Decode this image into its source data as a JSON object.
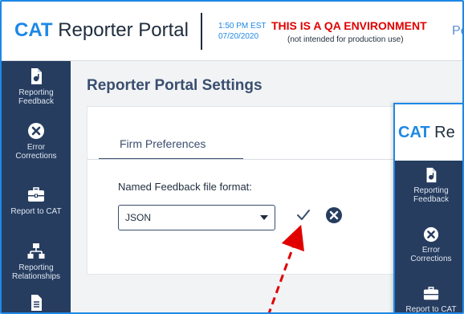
{
  "header": {
    "brand_prefix": "CAT",
    "brand_suffix": " Reporter Portal",
    "time": "1:50 PM EST",
    "date": "07/20/2020",
    "qa_warning": "THIS IS A QA ENVIRONMENT",
    "qa_subtitle": "(not intended for production use)",
    "cut_text": "Pe"
  },
  "sidebar": {
    "items": [
      {
        "label_1": "Reporting",
        "label_2": "Feedback",
        "icon": "document-icon"
      },
      {
        "label_1": "Error",
        "label_2": "Corrections",
        "icon": "error-x-icon"
      },
      {
        "label_1": "Report to CAT",
        "label_2": "",
        "icon": "briefcase-icon"
      },
      {
        "label_1": "Reporting",
        "label_2": "Relationships",
        "icon": "hierarchy-icon"
      }
    ]
  },
  "main": {
    "title": "Reporter Portal Settings",
    "tab_label": "Firm Preferences",
    "field_label": "Named Feedback file format:",
    "select_value": "JSON"
  },
  "overlay": {
    "brand_prefix": "CAT",
    "brand_suffix": " Re",
    "items": [
      {
        "label_1": "Reporting",
        "label_2": "Feedback"
      },
      {
        "label_1": "Error",
        "label_2": "Corrections"
      },
      {
        "label_1": "Report to CAT",
        "label_2": ""
      }
    ]
  },
  "colors": {
    "accent": "#1e88e5",
    "sidebar": "#263d60",
    "warning": "#e00000",
    "annotation": "#e00000"
  }
}
